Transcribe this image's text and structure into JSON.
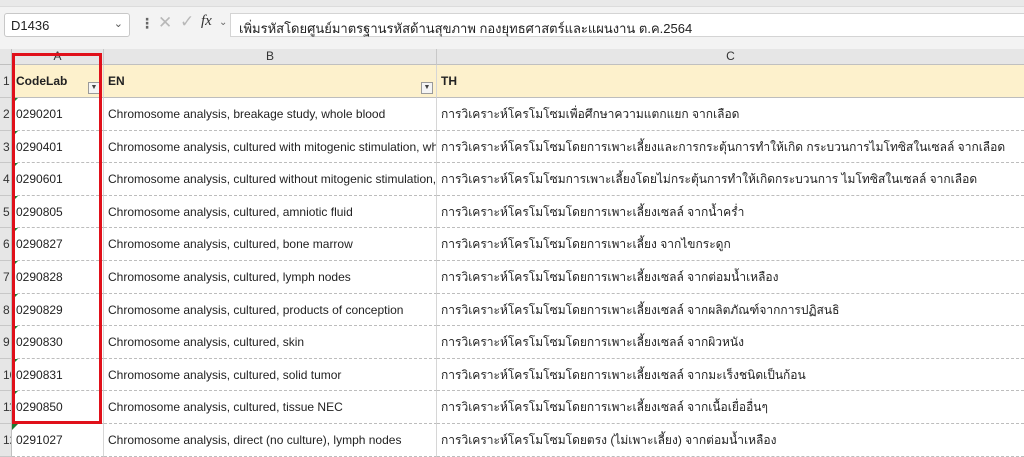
{
  "formula_bar": {
    "name_box": "D1436",
    "dropdown_icon": "chevron-down-icon",
    "more_icon": "vertical-dots-icon",
    "cancel_icon": "cross-icon",
    "enter_icon": "check-icon",
    "fx_label": "fx",
    "formula": "เพิ่มรหัสโดยศูนย์มาตรฐานรหัสด้านสุขภาพ กองยุทธศาสตร์และแผนงาน ต.ค.2564"
  },
  "columns": [
    {
      "letter": "A"
    },
    {
      "letter": "B"
    },
    {
      "letter": "C"
    }
  ],
  "header_row": {
    "row_number": "1",
    "codelab": "CodeLab",
    "en": "EN",
    "th": "TH"
  },
  "rows": [
    {
      "num": "2",
      "code": "0290201",
      "en": "Chromosome analysis, breakage study, whole blood",
      "th": "การวิเคราะห์โครโมโซมเพื่อศึกษาความแตกแยก  จากเลือด"
    },
    {
      "num": "3",
      "code": "0290401",
      "en": "Chromosome analysis, cultured with mitogenic stimulation, whole blood",
      "th": "การวิเคราะห์โครโมโซมโดยการเพาะเลี้ยงและการกระตุ้นการทำให้เกิด กระบวนการไมโทซิสในเซลล์  จากเลือด"
    },
    {
      "num": "4",
      "code": "0290601",
      "en": "Chromosome analysis, cultured without mitogenic stimulation, whole blood",
      "th": "การวิเคราะห์โครโมโซมการเพาะเลี้ยงโดยไม่กระตุ้นการทำให้เกิดกระบวนการ ไมโทซิสในเซลล์  จากเลือด"
    },
    {
      "num": "5",
      "code": "0290805",
      "en": "Chromosome analysis, cultured, amniotic fluid",
      "th": "การวิเคราะห์โครโมโซมโดยการเพาะเลี้ยงเซลล์  จากน้ำคร่ำ"
    },
    {
      "num": "6",
      "code": "0290827",
      "en": "Chromosome analysis, cultured, bone marrow",
      "th": "การวิเคราะห์โครโมโซมโดยการเพาะเลี้ยง  จากไขกระดูก"
    },
    {
      "num": "7",
      "code": "0290828",
      "en": "Chromosome analysis, cultured, lymph nodes",
      "th": "การวิเคราะห์โครโมโซมโดยการเพาะเลี้ยงเซลล์  จากต่อมน้ำเหลือง"
    },
    {
      "num": "8",
      "code": "0290829",
      "en": "Chromosome analysis, cultured, products of conception",
      "th": "การวิเคราะห์โครโมโซมโดยการเพาะเลี้ยงเซลล์  จากผลิตภัณฑ์จากการปฏิสนธิ"
    },
    {
      "num": "9",
      "code": "0290830",
      "en": "Chromosome analysis, cultured, skin",
      "th": "การวิเคราะห์โครโมโซมโดยการเพาะเลี้ยงเซลล์  จากผิวหนัง"
    },
    {
      "num": "10",
      "code": "0290831",
      "en": "Chromosome analysis, cultured, solid tumor",
      "th": "การวิเคราะห์โครโมโซมโดยการเพาะเลี้ยงเซลล์  จากมะเร็งชนิดเป็นก้อน"
    },
    {
      "num": "11",
      "code": "0290850",
      "en": "Chromosome analysis, cultured, tissue NEC",
      "th": "การวิเคราะห์โครโมโซมโดยการเพาะเลี้ยงเซลล์  จากเนื้อเยื่ออื่นๆ"
    },
    {
      "num": "12",
      "code": "0291027",
      "en": "Chromosome analysis, direct (no culture), lymph nodes",
      "th": "การวิเคราะห์โครโมโซมโดยตรง (ไม่เพาะเลี้ยง) จากต่อมน้ำเหลือง"
    }
  ],
  "annotation": {
    "color": "#e0101a"
  },
  "colors": {
    "header_fill": "#fdf1cc",
    "comment_marker": "#1e7a33"
  }
}
